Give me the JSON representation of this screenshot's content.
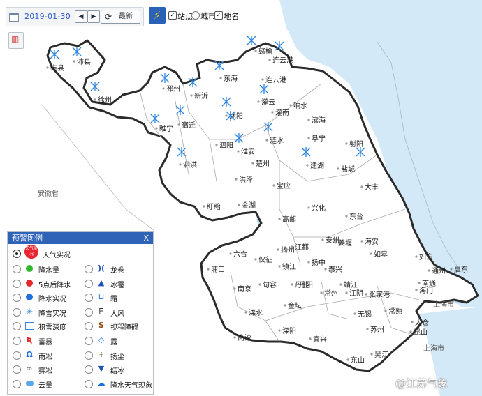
{
  "toolbar": {
    "date": "2019-01-30",
    "prev": "◀",
    "next": "▶",
    "latest": "最新"
  },
  "layers": {
    "station": "站点",
    "city": "城市",
    "placename": "地名"
  },
  "legend": {
    "title": "预警图例",
    "close": "X",
    "selected": "天气实况",
    "badge_text": "天气实况",
    "left": [
      "降水量",
      "5点后降水",
      "降水实况",
      "降雪实况",
      "积雪深度",
      "雷暴",
      "雨凇",
      "雾凇",
      "云量"
    ],
    "right": [
      "龙卷",
      "冰雹",
      "霜",
      "大风",
      "视程障碍",
      "露",
      "扬尘",
      "结冰",
      "降水天气现象"
    ]
  },
  "map": {
    "colors": {
      "sea": "#d4e9f8",
      "land": "#ffffff",
      "lake": "#b9d7ee",
      "border": "#2b2b2b",
      "county_line": "#aaaaaa",
      "snow_marker": "#2e86de"
    },
    "region_labels": [
      "安徽省",
      "上海市",
      "上海市"
    ],
    "places": [
      "丰县",
      "沛县",
      "徐州",
      "邳州",
      "新沂",
      "东海",
      "赣榆",
      "连云港",
      "连云港",
      "灌云",
      "响水",
      "灌南",
      "沭阳",
      "宿迁",
      "睢宁",
      "泗阳",
      "滨海",
      "阜宁",
      "射阳",
      "涟水",
      "淮安",
      "泗洪",
      "盱眙",
      "洪泽",
      "楚州",
      "建湖",
      "盐城",
      "宝应",
      "大丰",
      "金湖",
      "高邮",
      "兴化",
      "东台",
      "六合",
      "扬州",
      "江都",
      "泰州",
      "姜堰",
      "海安",
      "如皋",
      "浦口",
      "仪征",
      "南京",
      "句容",
      "丹徒",
      "镇江",
      "扬中",
      "泰兴",
      "靖江",
      "如东",
      "通州",
      "启东",
      "海门",
      "南通",
      "溧水",
      "丹阳",
      "金坛",
      "常州",
      "江阴",
      "张家港",
      "常熟",
      "太仓",
      "昆山",
      "苏州",
      "无锡",
      "溧阳",
      "宜兴",
      "高淳",
      "吴江",
      "东山"
    ]
  },
  "watermark": "@江苏气象"
}
